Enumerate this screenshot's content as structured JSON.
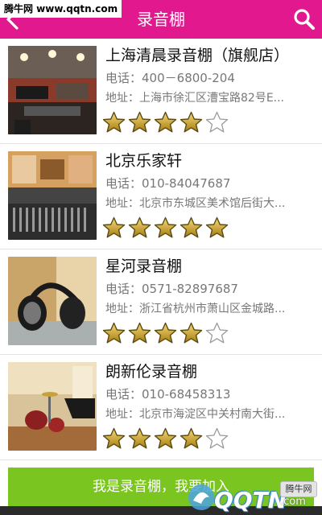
{
  "watermark": {
    "top_left": "腾牛网 www.qqtn.com",
    "badge": "腾牛网",
    "logo": "QQTN",
    "logo_suffix": ".com"
  },
  "header": {
    "title": "录音棚",
    "back_icon": "chevron-left-icon",
    "search_icon": "search-icon",
    "bg_color": "#e2198e"
  },
  "studios": [
    {
      "name": "上海清晨录音棚（旗舰店）",
      "phone_label": "电话：",
      "phone": "400－6800-204",
      "address_label": "地址：",
      "address": "上海市徐汇区漕宝路82号E...",
      "rating": 4,
      "max_rating": 5
    },
    {
      "name": "北京乐家轩",
      "phone_label": "电话：",
      "phone": "010-84047687",
      "address_label": "地址：",
      "address": "北京市东城区美术馆后街大...",
      "rating": 5,
      "max_rating": 5
    },
    {
      "name": "星河录音棚",
      "phone_label": "电话：",
      "phone": "0571-82897687",
      "address_label": "地址：",
      "address": "浙江省杭州市萧山区金城路...",
      "rating": 4,
      "max_rating": 5
    },
    {
      "name": "朗新伦录音棚",
      "phone_label": "电话：",
      "phone": "010-68458313",
      "address_label": "地址：",
      "address": "北京市海淀区中关村南大街...",
      "rating": 4,
      "max_rating": 5
    }
  ],
  "banner": {
    "text": "我是录音棚，我要加入",
    "bg_color": "#7bc520"
  },
  "colors": {
    "star_filled": "#c9a227",
    "star_empty": "#9a9a9a",
    "divider": "#e3e3e3"
  }
}
